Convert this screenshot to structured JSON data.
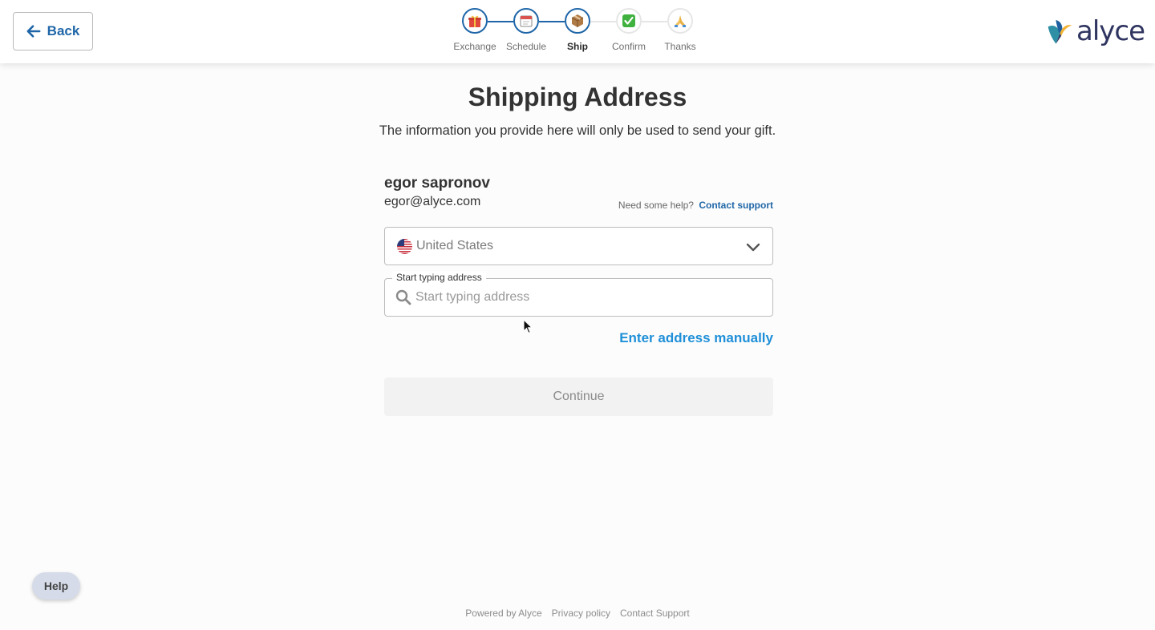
{
  "header": {
    "back_label": "Back",
    "logo_text": "alyce",
    "steps": [
      {
        "label": "Exchange",
        "icon": "gift-icon",
        "state": "done"
      },
      {
        "label": "Schedule",
        "icon": "calendar-icon",
        "state": "done"
      },
      {
        "label": "Ship",
        "icon": "package-icon",
        "state": "current"
      },
      {
        "label": "Confirm",
        "icon": "checkmark-icon",
        "state": "upcoming"
      },
      {
        "label": "Thanks",
        "icon": "praying-hands-icon",
        "state": "upcoming"
      }
    ]
  },
  "main": {
    "title": "Shipping Address",
    "subtitle": "The information you provide here will only be used to send your gift.",
    "user_name": "egor sapronov",
    "user_email": "egor@alyce.com",
    "help_prompt": "Need some help?",
    "help_link": "Contact support",
    "country": "United States",
    "address_label": "Start typing address",
    "address_placeholder": "Start typing address",
    "address_value": "",
    "manual_link": "Enter address manually",
    "continue_label": "Continue"
  },
  "help_button": "Help",
  "footer": {
    "links": [
      "Powered by Alyce",
      "Privacy policy",
      "Contact Support"
    ]
  },
  "colors": {
    "primary": "#1f66a8",
    "link_blue": "#1e8fd8",
    "logo_navy": "#2f3560",
    "disabled_button": "#f2f2f2"
  }
}
